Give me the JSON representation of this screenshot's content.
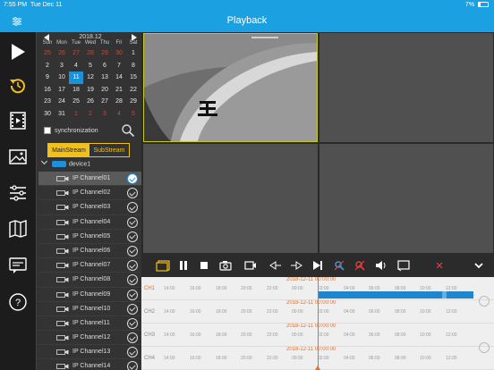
{
  "status_bar": {
    "time": "7:55 PM",
    "date": "Tue Dec 11",
    "battery": "7%"
  },
  "nav": {
    "title": "Playback"
  },
  "sidebar": {
    "items": [
      {
        "name": "live-play-icon"
      },
      {
        "name": "playback-icon"
      },
      {
        "name": "video-files-icon"
      },
      {
        "name": "image-files-icon"
      },
      {
        "name": "settings-sliders-icon"
      },
      {
        "name": "map-icon"
      },
      {
        "name": "messages-icon"
      },
      {
        "name": "help-icon"
      }
    ]
  },
  "calendar": {
    "month_label": "2018.12",
    "weekdays": [
      "Sun",
      "Mon",
      "Tue",
      "Wed",
      "Thu",
      "Fri",
      "Sat"
    ],
    "selected_day": "11",
    "weeks": [
      [
        "25",
        "26",
        "27",
        "28",
        "29",
        "30",
        "1"
      ],
      [
        "2",
        "3",
        "4",
        "5",
        "6",
        "7",
        "8"
      ],
      [
        "9",
        "10",
        "11",
        "12",
        "13",
        "14",
        "15"
      ],
      [
        "16",
        "17",
        "18",
        "19",
        "20",
        "21",
        "22"
      ],
      [
        "23",
        "24",
        "25",
        "26",
        "27",
        "28",
        "29"
      ],
      [
        "30",
        "31",
        "1",
        "2",
        "3",
        "4",
        "5"
      ]
    ]
  },
  "sync": {
    "label": "synchronization",
    "checked": false
  },
  "streams": {
    "main": "MainStream",
    "sub": "SubStream",
    "active": "main"
  },
  "device": {
    "label": "device1"
  },
  "channels": [
    {
      "label": "IP Channel01",
      "selected": true
    },
    {
      "label": "IP Channel02",
      "selected": false
    },
    {
      "label": "IP Channel03",
      "selected": false
    },
    {
      "label": "IP Channel04",
      "selected": false
    },
    {
      "label": "IP Channel05",
      "selected": false
    },
    {
      "label": "IP Channel06",
      "selected": false
    },
    {
      "label": "IP Channel07",
      "selected": false
    },
    {
      "label": "IP Channel08",
      "selected": false
    },
    {
      "label": "IP Channel09",
      "selected": false
    },
    {
      "label": "IP Channel10",
      "selected": false
    },
    {
      "label": "IP Channel11",
      "selected": false
    },
    {
      "label": "IP Channel12",
      "selected": false
    },
    {
      "label": "IP Channel13",
      "selected": false
    },
    {
      "label": "IP Channel14",
      "selected": false
    }
  ],
  "toolbar": {
    "buttons": [
      "folder-icon",
      "pause-icon",
      "stop-icon",
      "snapshot-icon",
      "record-icon",
      "rewind-icon",
      "forward-icon",
      "next-frame-icon",
      "audio-icon",
      "mute-icon",
      "volume-icon",
      "cast-icon",
      "close-icon",
      "dropdown-icon"
    ],
    "accent": "#e07030"
  },
  "timeline": {
    "rows": [
      {
        "channel": "CH1",
        "date": "2018-12-11  00:00:00",
        "ticks": [
          "14:00",
          "16:00",
          "18:00",
          "20:00",
          "22:00",
          "00:00",
          "02:00",
          "04:00",
          "06:00",
          "08:00",
          "10:00",
          "12:00"
        ],
        "active": true
      },
      {
        "channel": "CH2",
        "date": "2018-12-11  00:00:00",
        "ticks": [
          "14:00",
          "16:00",
          "18:00",
          "20:00",
          "22:00",
          "00:00",
          "02:00",
          "04:00",
          "06:00",
          "08:00",
          "10:00",
          "12:00"
        ],
        "active": false
      },
      {
        "channel": "CH3",
        "date": "2018-12-11  00:00:00",
        "ticks": [
          "14:00",
          "16:00",
          "18:00",
          "20:00",
          "22:00",
          "00:00",
          "02:00",
          "04:00",
          "06:00",
          "08:00",
          "10:00",
          "12:00"
        ],
        "active": false
      },
      {
        "channel": "CH4",
        "date": "2018-12-11  00:00:00",
        "ticks": [
          "14:00",
          "16:00",
          "18:00",
          "20:00",
          "22:00",
          "00:00",
          "02:00",
          "04:00",
          "06:00",
          "08:00",
          "10:00",
          "12:00"
        ],
        "active": false
      }
    ]
  },
  "colors": {
    "brand": "#1ba1e2",
    "selected_day": "#1e90d8",
    "stream_active": "#f0c020",
    "recording_bar": "#1f85cc"
  }
}
